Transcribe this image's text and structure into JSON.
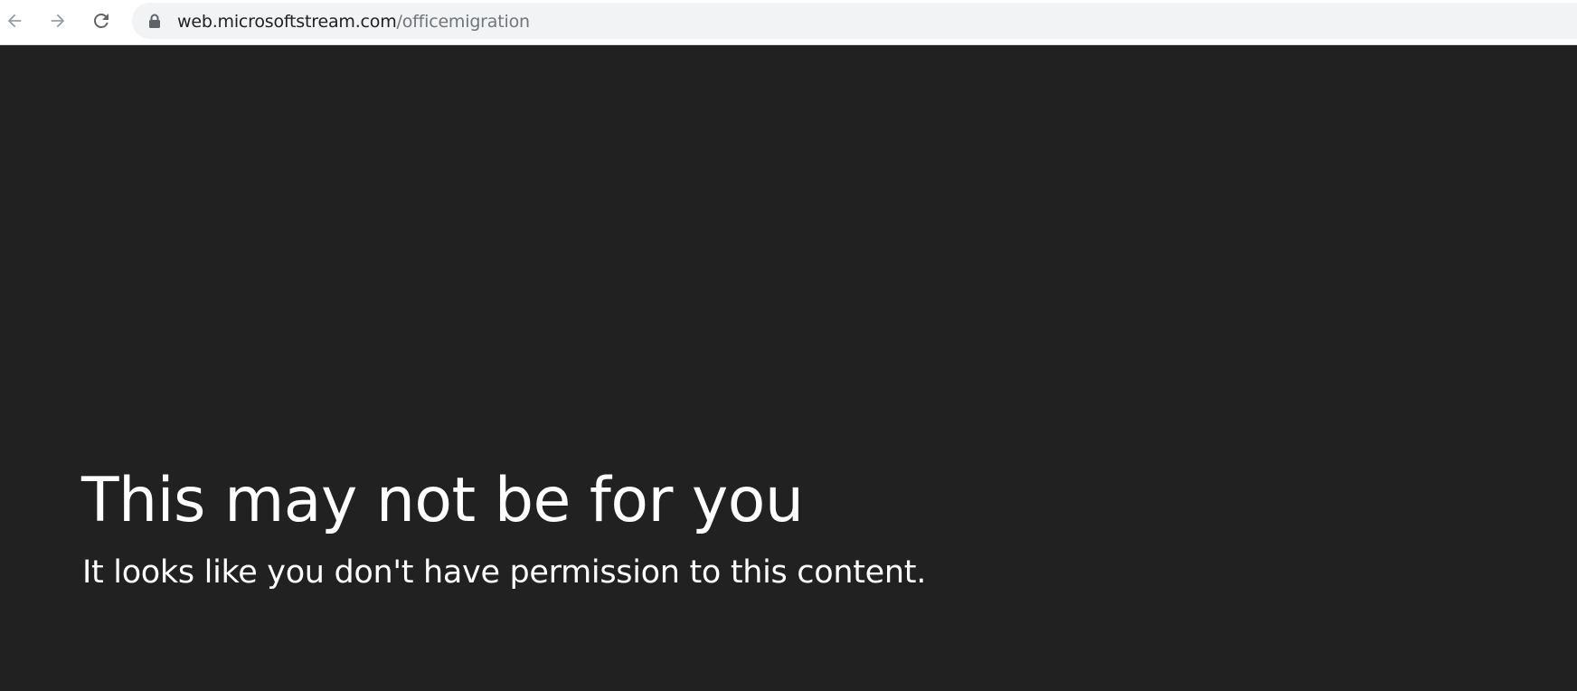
{
  "browser": {
    "url_host": "web.microsoftstream.com",
    "url_path": "/officemigration",
    "icons": {
      "back": "arrow-left-icon",
      "forward": "arrow-right-icon",
      "reload": "reload-icon",
      "lock": "lock-icon"
    }
  },
  "page": {
    "title": "This may not be for you",
    "message": "It looks like you don't have permission to this content."
  },
  "colors": {
    "background": "#212121",
    "text": "#ffffff",
    "omnibox": "#f1f3f4",
    "url_host": "#202124",
    "url_path": "#70757a"
  }
}
